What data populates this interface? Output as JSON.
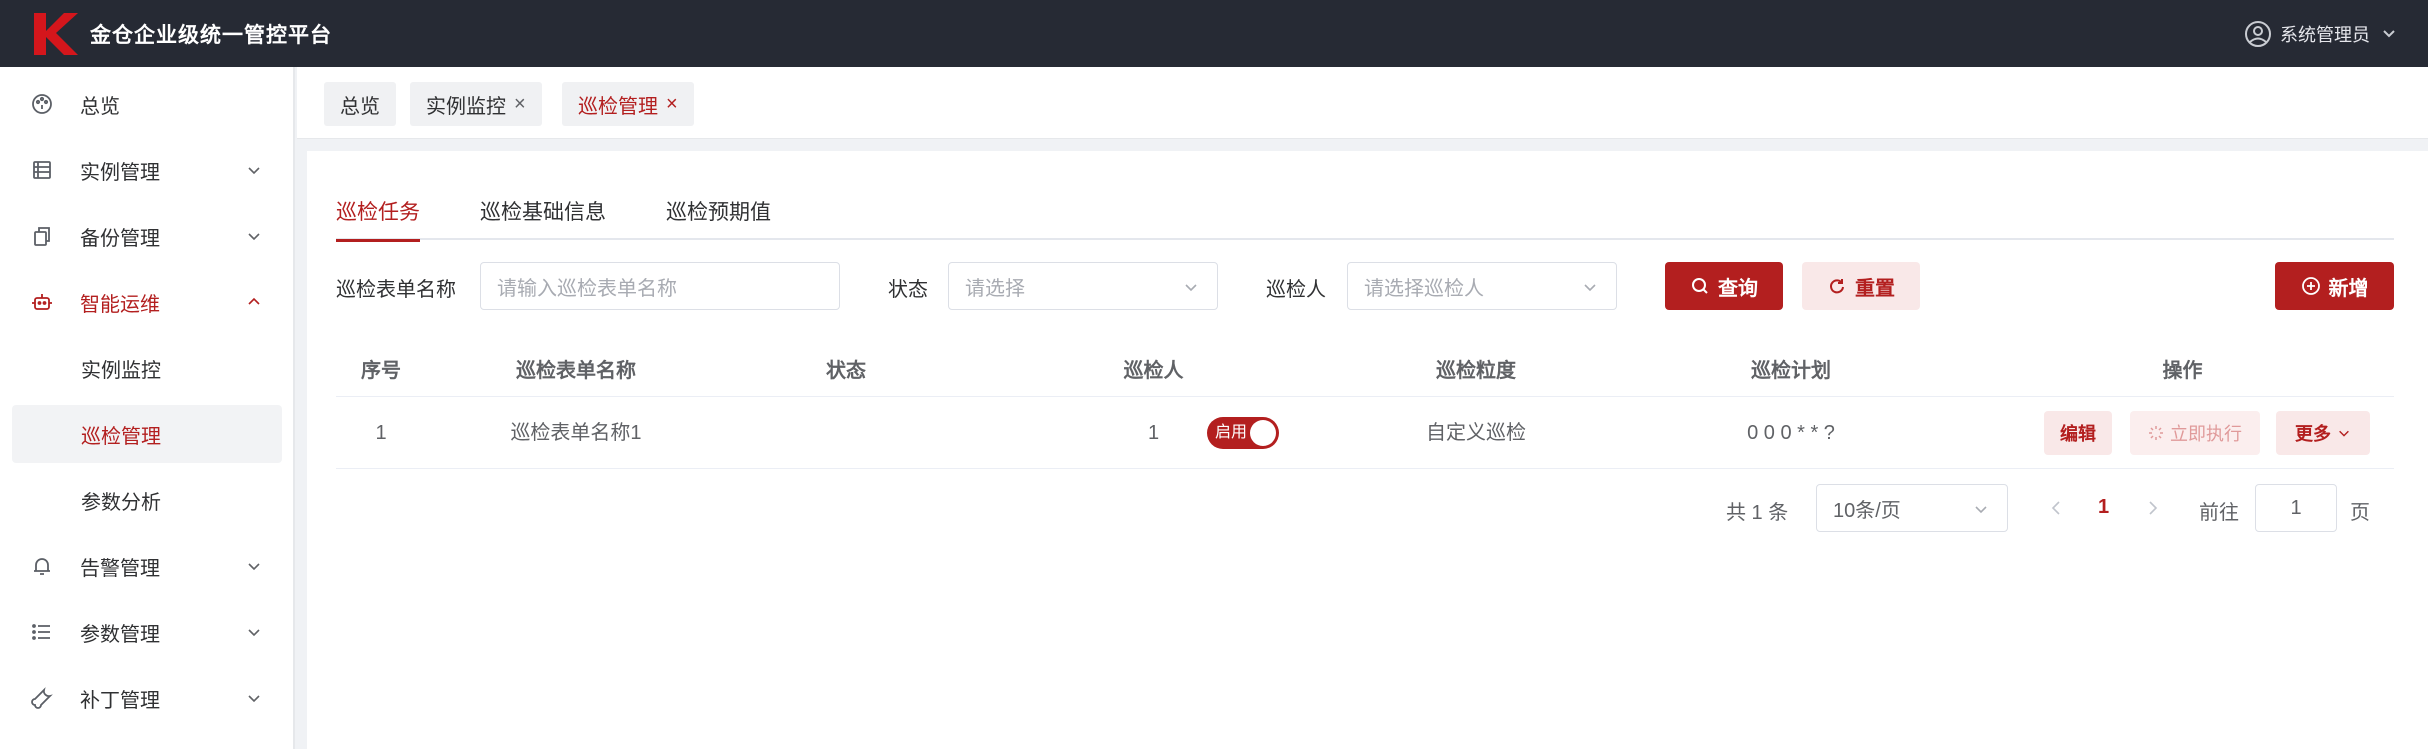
{
  "app": {
    "title": "金仓企业级统一管控平台",
    "user": "系统管理员"
  },
  "sidebar": {
    "items": [
      {
        "label": "总览",
        "icon": "dashboard-icon"
      },
      {
        "label": "实例管理",
        "icon": "database-icon"
      },
      {
        "label": "备份管理",
        "icon": "copy-icon"
      },
      {
        "label": "智能运维",
        "icon": "robot-icon"
      },
      {
        "label": "告警管理",
        "icon": "bell-icon"
      },
      {
        "label": "参数管理",
        "icon": "list-icon"
      },
      {
        "label": "补丁管理",
        "icon": "wrench-icon"
      }
    ],
    "sub_items": [
      {
        "label": "实例监控"
      },
      {
        "label": "巡检管理"
      },
      {
        "label": "参数分析"
      }
    ]
  },
  "page_tabs": [
    {
      "label": "总览"
    },
    {
      "label": "实例监控"
    },
    {
      "label": "巡检管理"
    }
  ],
  "sub_tabs": [
    "巡检任务",
    "巡检基础信息",
    "巡检预期值"
  ],
  "filters": {
    "name_label": "巡检表单名称",
    "name_placeholder": "请输入巡检表单名称",
    "status_label": "状态",
    "status_placeholder": "请选择",
    "inspector_label": "巡检人",
    "inspector_placeholder": "请选择巡检人",
    "query_button": "查询",
    "reset_button": "重置",
    "add_button": "新增"
  },
  "table": {
    "columns": [
      "序号",
      "巡检表单名称",
      "状态",
      "巡检人",
      "巡检粒度",
      "巡检计划",
      "操作"
    ],
    "rows": [
      {
        "index": "1",
        "name": "巡检表单名称1",
        "status": "启用",
        "inspector": "1",
        "granularity": "自定义巡检",
        "plan": "0 0 0 * * ?"
      }
    ],
    "actions": {
      "edit": "编辑",
      "run": "立即执行",
      "more": "更多"
    }
  },
  "pagination": {
    "total": "共 1 条",
    "page_size": "10条/页",
    "current_page": "1",
    "goto_label": "前往",
    "goto_value": "1",
    "page_suffix": "页"
  },
  "colors": {
    "accent": "#b31f1f",
    "topbar": "#262a34"
  }
}
